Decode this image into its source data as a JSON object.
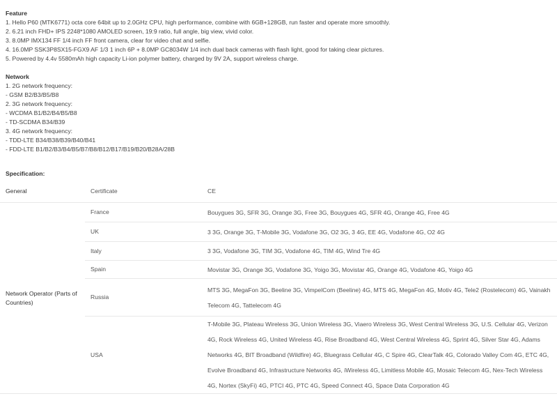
{
  "feature": {
    "title": "Feature",
    "lines": [
      "1. Hello P60 (MTK6771) octa core 64bit up to 2.0GHz CPU, high performance, combine with 6GB+128GB, run faster and operate more smoothly.",
      "2. 6.21 inch FHD+ IPS 2248*1080 AMOLED screen, 19:9 ratio, full angle, big view, vivid color.",
      "3. 8.0MP IMX134 FF 1/4 inch FF front camera, clear for video chat and selfie.",
      "4. 16.0MP SSK3P8SX15-FGX9 AF 1/3 1 inch 6P + 8.0MP GC8034W 1/4 inch dual back cameras with flash light, good for taking clear pictures.",
      "5. Powered by 4.4v 5580mAh high capacity Li-ion polymer battery, charged by 9V 2A, support wireless charge."
    ]
  },
  "network": {
    "title": "Network",
    "lines": [
      "1. 2G network frequency:",
      "- GSM B2/B3/B5/B8",
      "2. 3G network frequency:",
      "- WCDMA B1/B2/B4/B5/B8",
      "- TD-SCDMA B34/B39",
      "3. 4G network frequency:",
      "- TDD-LTE B34/B38/B39/B40/B41",
      "- FDD-LTE B1/B2/B3/B4/B5/B7/B8/B12/B17/B19/B20/B28A/28B"
    ]
  },
  "specification": {
    "title": "Specification:",
    "general": {
      "label": "General",
      "key": "Certificate",
      "value": "CE"
    },
    "network_operator_label": "Network Operator (Parts of Countries)",
    "operators": [
      {
        "country": "France",
        "value": "Bouygues 3G, SFR 3G, Orange 3G, Free 3G, Bouygues 4G, SFR 4G, Orange 4G, Free 4G"
      },
      {
        "country": "UK",
        "value": "3 3G, Orange 3G, T-Mobile 3G, Vodafone 3G, O2 3G, 3 4G, EE 4G, Vodafone 4G, O2 4G"
      },
      {
        "country": "Italy",
        "value": "3 3G, Vodafone 3G, TIM 3G, Vodafone 4G, TIM 4G, Wind Tre 4G"
      },
      {
        "country": "Spain",
        "value": "Movistar 3G, Orange 3G, Vodafone 3G, Yoigo 3G, Movistar 4G, Orange 4G, Vodafone 4G, Yoigo 4G"
      },
      {
        "country": "Russia",
        "value": "MTS 3G, MegaFon 3G, Beeline 3G, VimpelCom (Beeline) 4G, MTS 4G, MegaFon 4G, Motiv 4G, Tele2 (Rostelecom) 4G, Vainakh Telecom 4G, Tattelecom 4G"
      },
      {
        "country": "USA",
        "value": "T-Mobile 3G, Plateau Wireless 3G, Union Wireless 3G, Viaero Wireless 3G, West Central Wireless 3G, U.S. Cellular 4G, Verizon 4G, Rock Wireless 4G, United Wireless 4G, Rise Broadband 4G, West Central Wireless 4G, Sprint 4G, Silver Star 4G, Adams Networks 4G, BIT Broadband (Wildfire) 4G, Bluegrass Cellular 4G, C Spire 4G, ClearTalk 4G, Colorado Valley Com 4G, ETC 4G, Evolve Broadband 4G, Infrastructure Networks 4G, iWireless 4G, Limitless Mobile 4G, Mosaic Telecom 4G, Nex-Tech Wireless 4G, Nortex (SkyFi) 4G, PTCI 4G, PTC 4G, Speed Connect 4G, Space Data Corporation 4G"
      }
    ]
  }
}
